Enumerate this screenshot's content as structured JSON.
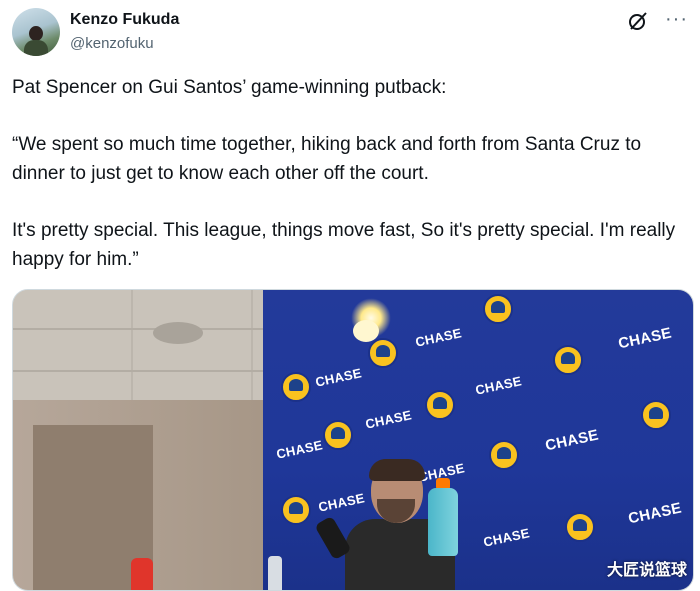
{
  "author": {
    "name": "Kenzo Fukuda",
    "handle": "@kenzofuku"
  },
  "header_icons": {
    "grok": "grok-icon",
    "more": "···"
  },
  "tweet": {
    "line1": "Pat Spencer on Gui Santos’ game-winning putback:",
    "line2": "“We spent so much time together, hiking back and forth from Santa Cruz to dinner to just get to know each other off the court.",
    "line3": "It's pretty special. This league, things move fast, So it's pretty special. I'm really happy for him.”"
  },
  "media": {
    "backdrop_text": "CHASE",
    "watermark": "大匠说篮球"
  }
}
